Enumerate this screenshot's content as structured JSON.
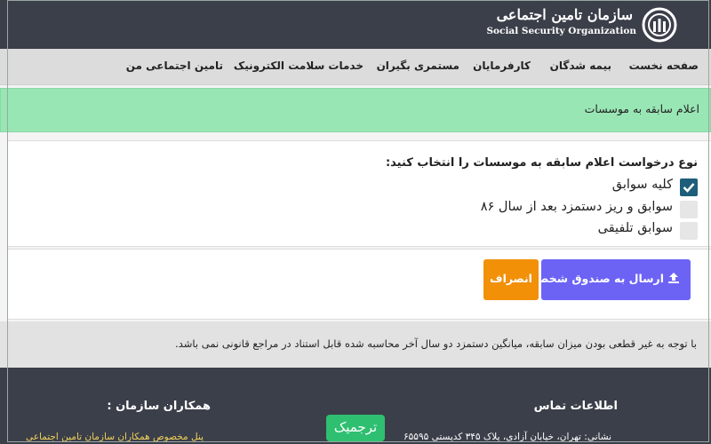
{
  "header": {
    "logo_fa": "سازمان تامین اجتماعی",
    "logo_en": "Social Security Organization"
  },
  "nav": {
    "items": [
      {
        "label": "صفحه نخست"
      },
      {
        "label": "بیمه شدگان"
      },
      {
        "label": "کارفرمایان"
      },
      {
        "label": "مستمری بگیران"
      },
      {
        "label": "خدمات سلامت الکترونیک"
      },
      {
        "label": "تامین اجتماعی من"
      }
    ]
  },
  "page": {
    "title": "اعلام سابقه به موسسات"
  },
  "form": {
    "question": "نوع درخواست اعلام سابقه به موسسات را انتخاب کنید:",
    "options": [
      {
        "label": "کلیه سوابق",
        "checked": true
      },
      {
        "label": "سوابق و ریز دستمزد بعد از سال ۸۶",
        "checked": false
      },
      {
        "label": "سوابق تلفیقی",
        "checked": false
      }
    ],
    "send_label": "ارسال به صندوق شخصی",
    "cancel_label": "انصراف"
  },
  "note": "با توجه به غیر قطعی بودن میزان سابقه، میانگین دستمزد دو سال آخر محاسبه شده قابل استناد در مراجع قانونی نمی باشد.",
  "footer": {
    "contact_title": "اطلاعات تماس",
    "contact_text": "نشانی: تهران، خیابان آزادی، پلاک ۳۴۵ کدپستی ۶۵۵۹۵",
    "partners_title": "همکاران سازمان :",
    "partners_text": "پنل مخصوص همکاران سازمان تامین اجتماعی"
  },
  "translate_label": "ترجمیک",
  "colors": {
    "header_bg": "#3b3f4a",
    "success_bg": "#99e6b5",
    "primary_button": "#6c63f5",
    "warning_button": "#f29008",
    "checkbox_checked": "#1e5e7a",
    "translate_button": "#2fbf71"
  }
}
